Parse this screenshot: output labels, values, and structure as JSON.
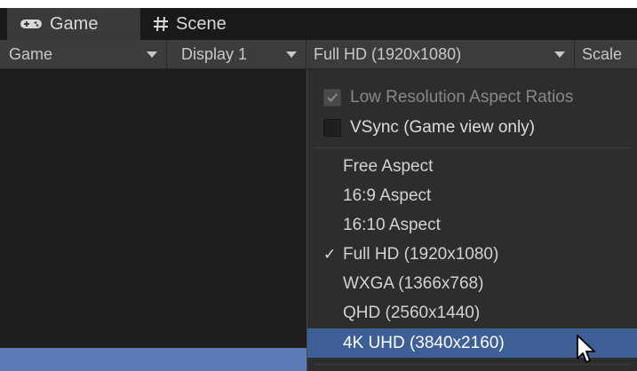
{
  "tabs": [
    {
      "label": "Game",
      "icon": "gamepad-icon"
    },
    {
      "label": "Scene",
      "icon": "hash-icon"
    }
  ],
  "toolbar": {
    "game_label": "Game",
    "display_label": "Display 1",
    "resolution_label": "Full HD (1920x1080)",
    "scale_label": "Scale"
  },
  "menu": {
    "low_res": {
      "label": "Low Resolution Aspect Ratios",
      "checked": true,
      "disabled": true
    },
    "vsync": {
      "label": "VSync (Game view only)",
      "checked": false
    },
    "items": [
      {
        "label": "Free Aspect",
        "checked": false,
        "highlighted": false
      },
      {
        "label": "16:9 Aspect",
        "checked": false,
        "highlighted": false
      },
      {
        "label": "16:10 Aspect",
        "checked": false,
        "highlighted": false
      },
      {
        "label": "Full HD (1920x1080)",
        "checked": true,
        "highlighted": false,
        "check_glyph": "✓"
      },
      {
        "label": "WXGA (1366x768)",
        "checked": false,
        "highlighted": false
      },
      {
        "label": "QHD (2560x1440)",
        "checked": false,
        "highlighted": false
      },
      {
        "label": "4K UHD (3840x2160)",
        "checked": false,
        "highlighted": true
      }
    ]
  },
  "colors": {
    "highlight": "#3e5f96",
    "menu_bg": "#2d2d2d",
    "toolbar_bg": "#3c3c3c"
  }
}
